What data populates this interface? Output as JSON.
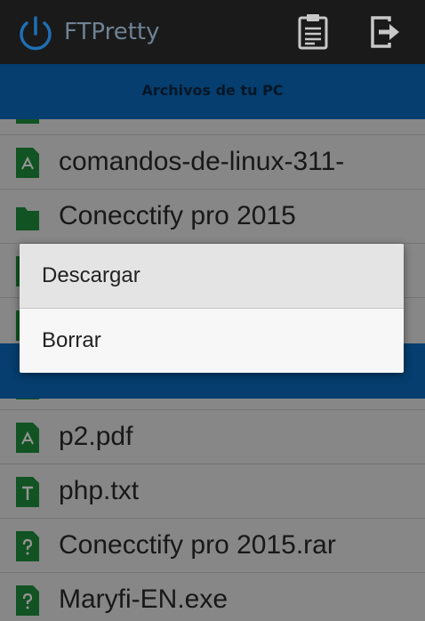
{
  "app": {
    "title": "FTPretty",
    "icon": "power-icon",
    "actions": [
      {
        "icon": "clipboard-icon"
      },
      {
        "icon": "exit-icon"
      }
    ]
  },
  "sections": [
    {
      "header": "Archivos de tu PC",
      "items": [
        {
          "label": "",
          "icon": "file-icon"
        },
        {
          "label": "comandos-de-linux-311-",
          "icon": "pdf-file-icon"
        },
        {
          "label": "Conecctify pro 2015",
          "icon": "folder-icon"
        },
        {
          "label": "",
          "icon": "file-icon"
        },
        {
          "label": "",
          "icon": "file-icon"
        }
      ]
    },
    {
      "header": "",
      "items": [
        {
          "label": "",
          "icon": "file-icon"
        },
        {
          "label": "p2.pdf",
          "icon": "pdf-file-icon"
        },
        {
          "label": "php.txt",
          "icon": "text-file-icon"
        },
        {
          "label": "Conecctify pro 2015.rar",
          "icon": "unknown-file-icon"
        },
        {
          "label": "Maryfi-EN.exe",
          "icon": "unknown-file-icon"
        }
      ]
    }
  ],
  "context_menu": {
    "items": [
      {
        "label": "Descargar"
      },
      {
        "label": "Borrar"
      }
    ]
  },
  "colors": {
    "appbar": "#1a1a1a",
    "header": "#0a6cbf",
    "icon_green": "#1e8f3c",
    "list_bg": "#e8e8e8"
  }
}
